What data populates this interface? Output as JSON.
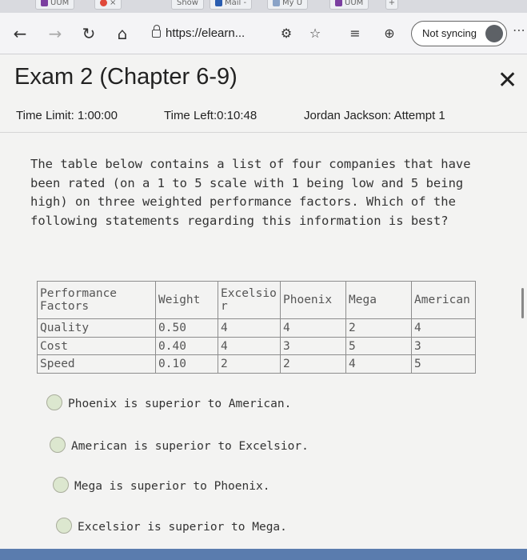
{
  "browser": {
    "tabs": [
      "UUM",
      "Show",
      "Mail -",
      "My U",
      "UUM"
    ],
    "address": "https://elearn...",
    "profile_button": "Not syncing"
  },
  "exam": {
    "title": "Exam 2 (Chapter 6-9)",
    "time_limit": "Time Limit: 1:00:00",
    "time_left": "Time Left:0:10:48",
    "attempt": "Jordan Jackson: Attempt 1",
    "question": "The table below contains a list of four companies that have been rated (on a 1 to 5 scale with 1 being low and 5 being high) on three weighted performance factors. Which of the following statements regarding this information is best?",
    "table": {
      "headers": [
        "Performance Factors",
        "Weight",
        "Excelsior",
        "Phoenix",
        "Mega",
        "American"
      ],
      "rows": [
        [
          "Quality",
          "0.50",
          "4",
          "4",
          "2",
          "4"
        ],
        [
          "Cost",
          "0.40",
          "4",
          "3",
          "5",
          "3"
        ],
        [
          "Speed",
          "0.10",
          "2",
          "2",
          "4",
          "5"
        ]
      ]
    },
    "options": [
      "Phoenix is superior to American.",
      "American is superior to Excelsior.",
      "Mega is superior to Phoenix.",
      "Excelsior is superior to Mega."
    ]
  }
}
